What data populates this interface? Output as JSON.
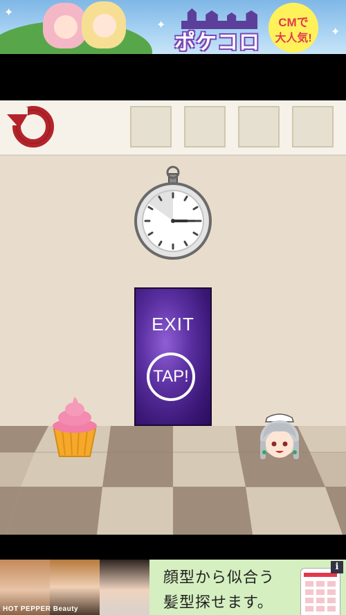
{
  "top_ad": {
    "logo_text": "ポケコロ",
    "badge_line1": "CMで",
    "badge_line2": "大人気!"
  },
  "game": {
    "inventory_slot_count": 4,
    "door": {
      "label": "EXIT",
      "tap_label": "TAP!"
    }
  },
  "bottom_ad": {
    "brand": "HOT PEPPER Beauty",
    "copy_line1": "顔型から似合う",
    "copy_line2": "髪型探せます。",
    "info_label": "i"
  },
  "colors": {
    "reset_icon": "#b3242a",
    "door_purple": "#5a2fa0",
    "wall": "#e8ddcc",
    "floor_dark": "#a08c7a",
    "floor_light": "#d6c9b6"
  }
}
